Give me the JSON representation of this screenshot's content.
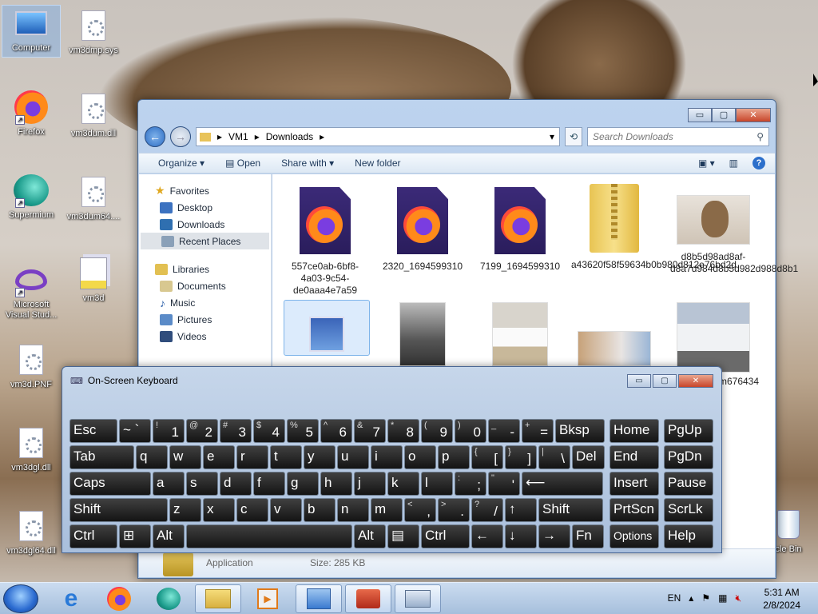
{
  "desktop": {
    "icons": [
      {
        "label": "Computer"
      },
      {
        "label": "vm3dmp.sys"
      },
      {
        "label": "Firefox"
      },
      {
        "label": "vm3dum.dll"
      },
      {
        "label": "Supermium"
      },
      {
        "label": "vm3dum64...."
      },
      {
        "label": "Microsoft Visual Stud..."
      },
      {
        "label": "vm3d"
      },
      {
        "label": "vm3d.PNF"
      },
      {
        "label": "vm3dgl.dll"
      },
      {
        "label": "vm3dgl64.dll"
      },
      {
        "label": "cle Bin"
      }
    ]
  },
  "explorer": {
    "controls": {
      "min": "▭",
      "max": "▢",
      "close": "✕"
    },
    "breadcrumb": [
      "VM1",
      "Downloads"
    ],
    "search_placeholder": "Search Downloads",
    "toolbar": {
      "organize": "Organize",
      "open": "Open",
      "share": "Share with",
      "new_folder": "New folder"
    },
    "nav": {
      "favorites": "Favorites",
      "desktop": "Desktop",
      "downloads": "Downloads",
      "recent": "Recent Places",
      "libraries": "Libraries",
      "documents": "Documents",
      "music": "Music",
      "pictures": "Pictures",
      "videos": "Videos"
    },
    "files": [
      {
        "name": "557ce0ab-6bf8-4a03-9c54-de0aaa4e7a59"
      },
      {
        "name": "2320_1694599310"
      },
      {
        "name": "7199_1694599310"
      },
      {
        "name": "a43620f58f59634b0b980d812e76bd2d"
      },
      {
        "name": "d8b5d98ad8af-d8a7d984d8b5d982d988d8b1"
      },
      {
        "name": "cting_m676434"
      }
    ],
    "details": {
      "type": "Application",
      "size": "Size: 285 KB"
    }
  },
  "osk": {
    "title": "On-Screen Keyboard",
    "rows": [
      [
        [
          "Esc",
          ""
        ],
        [
          "~ `",
          ""
        ],
        [
          "1",
          "!"
        ],
        [
          "2",
          "@"
        ],
        [
          "3",
          "#"
        ],
        [
          "4",
          "$"
        ],
        [
          "5",
          "%"
        ],
        [
          "6",
          "^"
        ],
        [
          "7",
          "&"
        ],
        [
          "8",
          "*"
        ],
        [
          "9",
          "("
        ],
        [
          "0",
          ")"
        ],
        [
          "-",
          "_"
        ],
        [
          "=",
          "+"
        ],
        [
          "Bksp",
          ""
        ],
        [
          "Home",
          ""
        ],
        [
          "PgUp",
          ""
        ]
      ],
      [
        [
          "Tab",
          ""
        ],
        [
          "q",
          ""
        ],
        [
          "w",
          ""
        ],
        [
          "e",
          ""
        ],
        [
          "r",
          ""
        ],
        [
          "t",
          ""
        ],
        [
          "y",
          ""
        ],
        [
          "u",
          ""
        ],
        [
          "i",
          ""
        ],
        [
          "o",
          ""
        ],
        [
          "p",
          ""
        ],
        [
          "[",
          "{"
        ],
        [
          "]",
          "}"
        ],
        [
          "\\",
          "|"
        ],
        [
          "Del",
          ""
        ],
        [
          "End",
          ""
        ],
        [
          "PgDn",
          ""
        ]
      ],
      [
        [
          "Caps",
          ""
        ],
        [
          "a",
          ""
        ],
        [
          "s",
          ""
        ],
        [
          "d",
          ""
        ],
        [
          "f",
          ""
        ],
        [
          "g",
          ""
        ],
        [
          "h",
          ""
        ],
        [
          "j",
          ""
        ],
        [
          "k",
          ""
        ],
        [
          "l",
          ""
        ],
        [
          ";",
          ":"
        ],
        [
          "'",
          "\""
        ],
        [
          "⟵",
          ""
        ],
        [
          "Insert",
          ""
        ],
        [
          "Pause",
          ""
        ]
      ],
      [
        [
          "Shift",
          ""
        ],
        [
          "z",
          ""
        ],
        [
          "x",
          ""
        ],
        [
          "c",
          ""
        ],
        [
          "v",
          ""
        ],
        [
          "b",
          ""
        ],
        [
          "n",
          ""
        ],
        [
          "m",
          ""
        ],
        [
          ",",
          "<"
        ],
        [
          ".",
          ">"
        ],
        [
          "/",
          "?"
        ],
        [
          "↑",
          ""
        ],
        [
          "Shift",
          ""
        ],
        [
          "PrtScn",
          ""
        ],
        [
          "ScrLk",
          ""
        ]
      ],
      [
        [
          "Ctrl",
          ""
        ],
        [
          "⊞",
          ""
        ],
        [
          "Alt",
          ""
        ],
        [
          "",
          ""
        ],
        [
          "Alt",
          ""
        ],
        [
          "▤",
          ""
        ],
        [
          "Ctrl",
          ""
        ],
        [
          "←",
          ""
        ],
        [
          "↓",
          ""
        ],
        [
          "→",
          ""
        ],
        [
          "Fn",
          ""
        ],
        [
          "Options",
          ""
        ],
        [
          "Help",
          ""
        ]
      ]
    ]
  },
  "taskbar": {
    "lang": "EN",
    "time": "5:31 AM",
    "date": "2/8/2024"
  }
}
